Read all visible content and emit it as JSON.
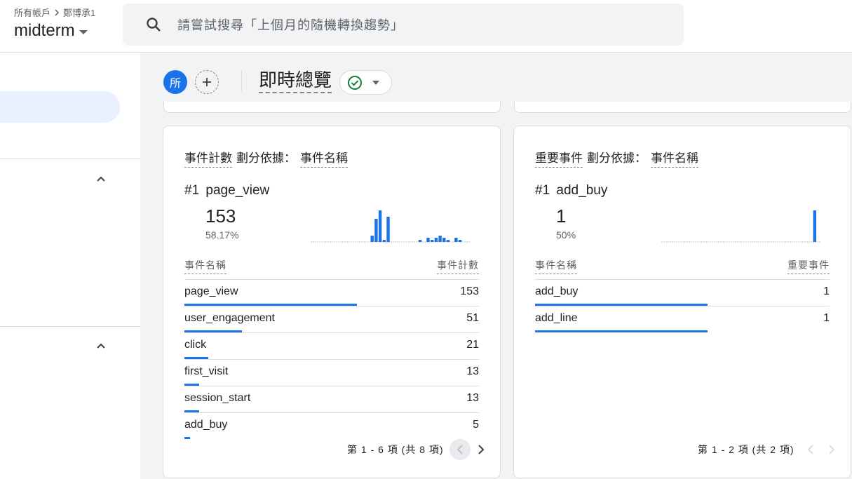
{
  "header": {
    "breadcrumb": [
      "所有帳戶",
      "鄭博承1"
    ],
    "property": "midterm",
    "search_placeholder": "請嘗試搜尋「上個月的隨機轉換趨勢」"
  },
  "toolbar": {
    "comparison_chip": "所",
    "add_icon": "plus-icon",
    "title": "即時總覽"
  },
  "cards": [
    {
      "metric": "事件計數",
      "split_label": "劃分依據：",
      "dimension": "事件名稱",
      "top_rank": "#1",
      "top_name": "page_view",
      "top_value": "153",
      "top_pct": "58.17%",
      "col_dimension": "事件名稱",
      "col_metric": "事件計數",
      "rows": [
        {
          "name": "page_view",
          "value": "153",
          "share": 1.0
        },
        {
          "name": "user_engagement",
          "value": "51",
          "share": 0.333
        },
        {
          "name": "click",
          "value": "21",
          "share": 0.137
        },
        {
          "name": "first_visit",
          "value": "13",
          "share": 0.085
        },
        {
          "name": "session_start",
          "value": "13",
          "share": 0.085
        },
        {
          "name": "add_buy",
          "value": "5",
          "share": 0.033
        }
      ],
      "sparkline": [
        0,
        0,
        0,
        0,
        0,
        0,
        0,
        0,
        0,
        0,
        0,
        0,
        0,
        0,
        0,
        3,
        11,
        15,
        1,
        12,
        0,
        0,
        0,
        0,
        0,
        0,
        0,
        1,
        0,
        2,
        1,
        2,
        3,
        2,
        1,
        0,
        2,
        1,
        0,
        0
      ],
      "pager": "第 1 - 6 項 (共 8 項)"
    },
    {
      "metric": "重要事件",
      "split_label": "劃分依據：",
      "dimension": "事件名稱",
      "top_rank": "#1",
      "top_name": "add_buy",
      "top_value": "1",
      "top_pct": "50%",
      "col_dimension": "事件名稱",
      "col_metric": "重要事件",
      "rows": [
        {
          "name": "add_buy",
          "value": "1",
          "share": 1.0
        },
        {
          "name": "add_line",
          "value": "1",
          "share": 1.0
        }
      ],
      "sparkline": [
        0,
        0,
        0,
        0,
        0,
        0,
        0,
        0,
        0,
        0,
        0,
        0,
        0,
        0,
        0,
        0,
        0,
        0,
        0,
        0,
        0,
        0,
        0,
        0,
        0,
        0,
        0,
        0,
        0,
        0,
        0,
        0,
        0,
        0,
        0,
        0,
        0,
        0,
        1,
        0
      ],
      "pager": "第 1 - 2 項 (共 2 項)"
    }
  ],
  "colors": {
    "accent": "#1a73e8",
    "check": "#188038"
  }
}
